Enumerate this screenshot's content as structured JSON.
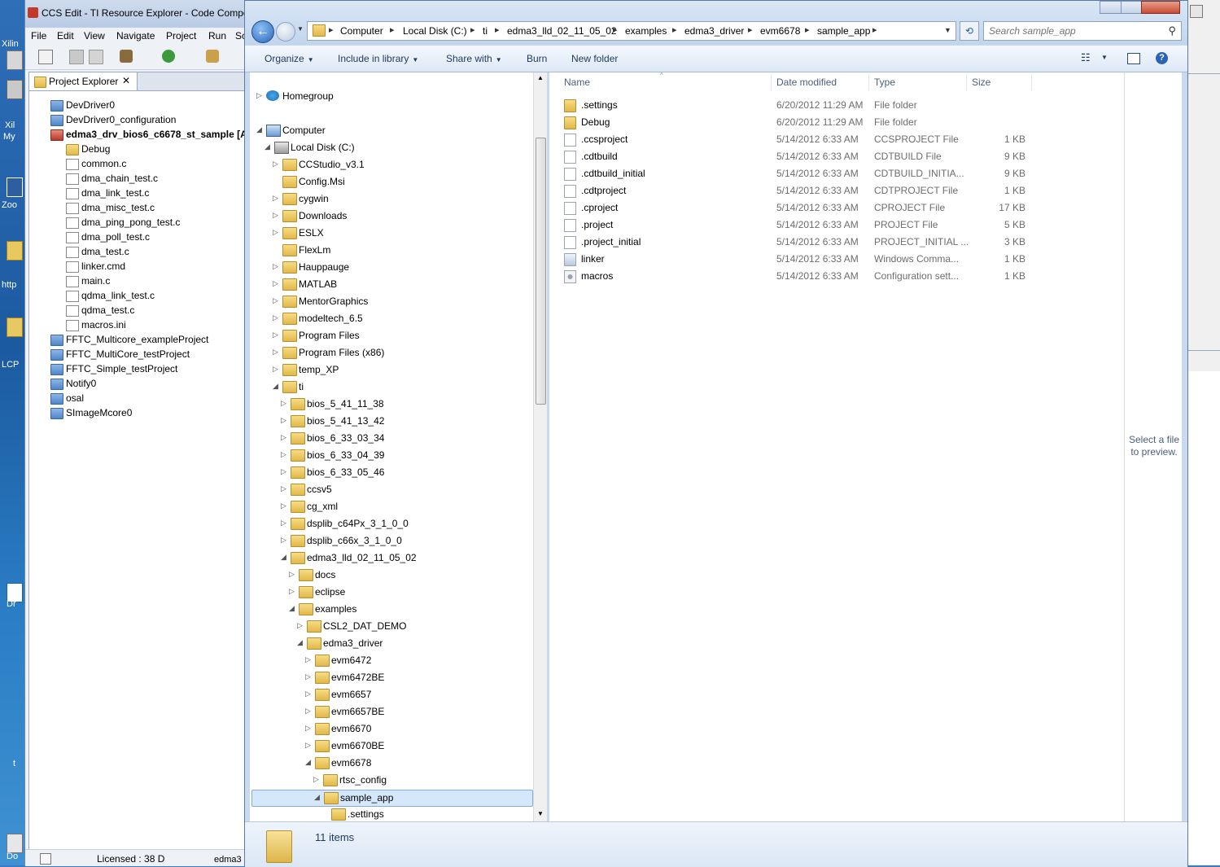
{
  "desktop": {
    "labels": [
      "Xilin",
      "Xil",
      "My",
      "Zoo",
      "http",
      "LCP",
      "Dr",
      "t",
      "Do"
    ]
  },
  "ccs": {
    "title": "CCS Edit - TI Resource Explorer - Code Compo",
    "menu": [
      "File",
      "Edit",
      "View",
      "Navigate",
      "Project",
      "Run",
      "Sc"
    ],
    "view_title": "Project Explorer",
    "tree": [
      {
        "label": "DevDriver0",
        "kind": "project",
        "indent": 0
      },
      {
        "label": "DevDriver0_configuration",
        "kind": "project",
        "indent": 0
      },
      {
        "label": "edma3_drv_bios6_c6678_st_sample  [Ac",
        "kind": "active-project",
        "indent": 0
      },
      {
        "label": "Debug",
        "kind": "folder",
        "indent": 1
      },
      {
        "label": "common.c",
        "kind": "c",
        "indent": 1
      },
      {
        "label": "dma_chain_test.c",
        "kind": "c",
        "indent": 1
      },
      {
        "label": "dma_link_test.c",
        "kind": "c",
        "indent": 1
      },
      {
        "label": "dma_misc_test.c",
        "kind": "c",
        "indent": 1
      },
      {
        "label": "dma_ping_pong_test.c",
        "kind": "c",
        "indent": 1
      },
      {
        "label": "dma_poll_test.c",
        "kind": "c",
        "indent": 1
      },
      {
        "label": "dma_test.c",
        "kind": "c",
        "indent": 1
      },
      {
        "label": "linker.cmd",
        "kind": "c",
        "indent": 1
      },
      {
        "label": "main.c",
        "kind": "c",
        "indent": 1
      },
      {
        "label": "qdma_link_test.c",
        "kind": "c",
        "indent": 1
      },
      {
        "label": "qdma_test.c",
        "kind": "c",
        "indent": 1
      },
      {
        "label": "macros.ini",
        "kind": "c",
        "indent": 1
      },
      {
        "label": "FFTC_Multicore_exampleProject",
        "kind": "project",
        "indent": 0
      },
      {
        "label": "FFTC_MultiCore_testProject",
        "kind": "project",
        "indent": 0
      },
      {
        "label": "FFTC_Simple_testProject",
        "kind": "project",
        "indent": 0
      },
      {
        "label": "Notify0",
        "kind": "project",
        "indent": 0
      },
      {
        "label": "osal",
        "kind": "project",
        "indent": 0
      },
      {
        "label": "SImageMcore0",
        "kind": "project",
        "indent": 0
      }
    ],
    "status": "Licensed : 38 D",
    "status2": "edma3"
  },
  "explorer": {
    "breadcrumb": [
      "Computer",
      "Local Disk (C:)",
      "ti",
      "edma3_lld_02_11_05_02",
      "examples",
      "edma3_driver",
      "evm6678",
      "sample_app"
    ],
    "search_placeholder": "Search sample_app",
    "commands": [
      {
        "label": "Organize",
        "dropdown": true
      },
      {
        "label": "Include in library",
        "dropdown": true
      },
      {
        "label": "Share with",
        "dropdown": true
      },
      {
        "label": "Burn",
        "dropdown": false
      },
      {
        "label": "New folder",
        "dropdown": false
      }
    ],
    "nav": [
      {
        "label": "Homegroup",
        "level": 0,
        "arrow": "closed",
        "icon": "homegroup"
      },
      {
        "label": "Computer",
        "level": 0,
        "arrow": "open",
        "icon": "computer"
      },
      {
        "label": "Local Disk (C:)",
        "level": 1,
        "arrow": "open",
        "icon": "drive"
      },
      {
        "label": "CCStudio_v3.1",
        "level": 2,
        "arrow": "closed",
        "icon": "folder"
      },
      {
        "label": "Config.Msi",
        "level": 2,
        "arrow": "none",
        "icon": "folder"
      },
      {
        "label": "cygwin",
        "level": 2,
        "arrow": "closed",
        "icon": "folder"
      },
      {
        "label": "Downloads",
        "level": 2,
        "arrow": "closed",
        "icon": "folder"
      },
      {
        "label": "ESLX",
        "level": 2,
        "arrow": "closed",
        "icon": "folder"
      },
      {
        "label": "FlexLm",
        "level": 2,
        "arrow": "none",
        "icon": "folder"
      },
      {
        "label": "Hauppauge",
        "level": 2,
        "arrow": "closed",
        "icon": "folder"
      },
      {
        "label": "MATLAB",
        "level": 2,
        "arrow": "closed",
        "icon": "folder"
      },
      {
        "label": "MentorGraphics",
        "level": 2,
        "arrow": "closed",
        "icon": "folder"
      },
      {
        "label": "modeltech_6.5",
        "level": 2,
        "arrow": "closed",
        "icon": "folder"
      },
      {
        "label": "Program Files",
        "level": 2,
        "arrow": "closed",
        "icon": "folder"
      },
      {
        "label": "Program Files (x86)",
        "level": 2,
        "arrow": "closed",
        "icon": "folder"
      },
      {
        "label": "temp_XP",
        "level": 2,
        "arrow": "closed",
        "icon": "folder"
      },
      {
        "label": "ti",
        "level": 2,
        "arrow": "open",
        "icon": "folder"
      },
      {
        "label": "bios_5_41_11_38",
        "level": 3,
        "arrow": "closed",
        "icon": "folder"
      },
      {
        "label": "bios_5_41_13_42",
        "level": 3,
        "arrow": "closed",
        "icon": "folder"
      },
      {
        "label": "bios_6_33_03_34",
        "level": 3,
        "arrow": "closed",
        "icon": "folder"
      },
      {
        "label": "bios_6_33_04_39",
        "level": 3,
        "arrow": "closed",
        "icon": "folder"
      },
      {
        "label": "bios_6_33_05_46",
        "level": 3,
        "arrow": "closed",
        "icon": "folder"
      },
      {
        "label": "ccsv5",
        "level": 3,
        "arrow": "closed",
        "icon": "folder"
      },
      {
        "label": "cg_xml",
        "level": 3,
        "arrow": "closed",
        "icon": "folder"
      },
      {
        "label": "dsplib_c64Px_3_1_0_0",
        "level": 3,
        "arrow": "closed",
        "icon": "folder"
      },
      {
        "label": "dsplib_c66x_3_1_0_0",
        "level": 3,
        "arrow": "closed",
        "icon": "folder"
      },
      {
        "label": "edma3_lld_02_11_05_02",
        "level": 3,
        "arrow": "open",
        "icon": "folder"
      },
      {
        "label": "docs",
        "level": 4,
        "arrow": "closed",
        "icon": "folder"
      },
      {
        "label": "eclipse",
        "level": 4,
        "arrow": "closed",
        "icon": "folder"
      },
      {
        "label": "examples",
        "level": 4,
        "arrow": "open",
        "icon": "folder"
      },
      {
        "label": "CSL2_DAT_DEMO",
        "level": 5,
        "arrow": "closed",
        "icon": "folder"
      },
      {
        "label": "edma3_driver",
        "level": 5,
        "arrow": "open",
        "icon": "folder"
      },
      {
        "label": "evm6472",
        "level": 6,
        "arrow": "closed",
        "icon": "folder"
      },
      {
        "label": "evm6472BE",
        "level": 6,
        "arrow": "closed",
        "icon": "folder"
      },
      {
        "label": "evm6657",
        "level": 6,
        "arrow": "closed",
        "icon": "folder"
      },
      {
        "label": "evm6657BE",
        "level": 6,
        "arrow": "closed",
        "icon": "folder"
      },
      {
        "label": "evm6670",
        "level": 6,
        "arrow": "closed",
        "icon": "folder"
      },
      {
        "label": "evm6670BE",
        "level": 6,
        "arrow": "closed",
        "icon": "folder"
      },
      {
        "label": "evm6678",
        "level": 6,
        "arrow": "open",
        "icon": "folder"
      },
      {
        "label": "rtsc_config",
        "level": 7,
        "arrow": "closed",
        "icon": "folder"
      },
      {
        "label": "sample_app",
        "level": 7,
        "arrow": "open",
        "icon": "folder",
        "selected": true
      },
      {
        "label": ".settings",
        "level": 8,
        "arrow": "none",
        "icon": "folder"
      }
    ],
    "columns": {
      "name": "Name",
      "date": "Date modified",
      "type": "Type",
      "size": "Size"
    },
    "files": [
      {
        "name": ".settings",
        "date": "6/20/2012 11:29 AM",
        "type": "File folder",
        "size": "",
        "icon": "folder"
      },
      {
        "name": "Debug",
        "date": "6/20/2012 11:29 AM",
        "type": "File folder",
        "size": "",
        "icon": "folder"
      },
      {
        "name": ".ccsproject",
        "date": "5/14/2012 6:33 AM",
        "type": "CCSPROJECT File",
        "size": "1 KB",
        "icon": "doc"
      },
      {
        "name": ".cdtbuild",
        "date": "5/14/2012 6:33 AM",
        "type": "CDTBUILD File",
        "size": "9 KB",
        "icon": "doc"
      },
      {
        "name": ".cdtbuild_initial",
        "date": "5/14/2012 6:33 AM",
        "type": "CDTBUILD_INITIA...",
        "size": "9 KB",
        "icon": "doc"
      },
      {
        "name": ".cdtproject",
        "date": "5/14/2012 6:33 AM",
        "type": "CDTPROJECT File",
        "size": "1 KB",
        "icon": "doc"
      },
      {
        "name": ".cproject",
        "date": "5/14/2012 6:33 AM",
        "type": "CPROJECT File",
        "size": "17 KB",
        "icon": "doc"
      },
      {
        "name": ".project",
        "date": "5/14/2012 6:33 AM",
        "type": "PROJECT File",
        "size": "5 KB",
        "icon": "doc"
      },
      {
        "name": ".project_initial",
        "date": "5/14/2012 6:33 AM",
        "type": "PROJECT_INITIAL ...",
        "size": "3 KB",
        "icon": "doc"
      },
      {
        "name": "linker",
        "date": "5/14/2012 6:33 AM",
        "type": "Windows Comma...",
        "size": "1 KB",
        "icon": "cmd"
      },
      {
        "name": "macros",
        "date": "5/14/2012 6:33 AM",
        "type": "Configuration sett...",
        "size": "1 KB",
        "icon": "ini"
      }
    ],
    "preview_text": "Select a file to preview.",
    "item_count": "11 items"
  }
}
